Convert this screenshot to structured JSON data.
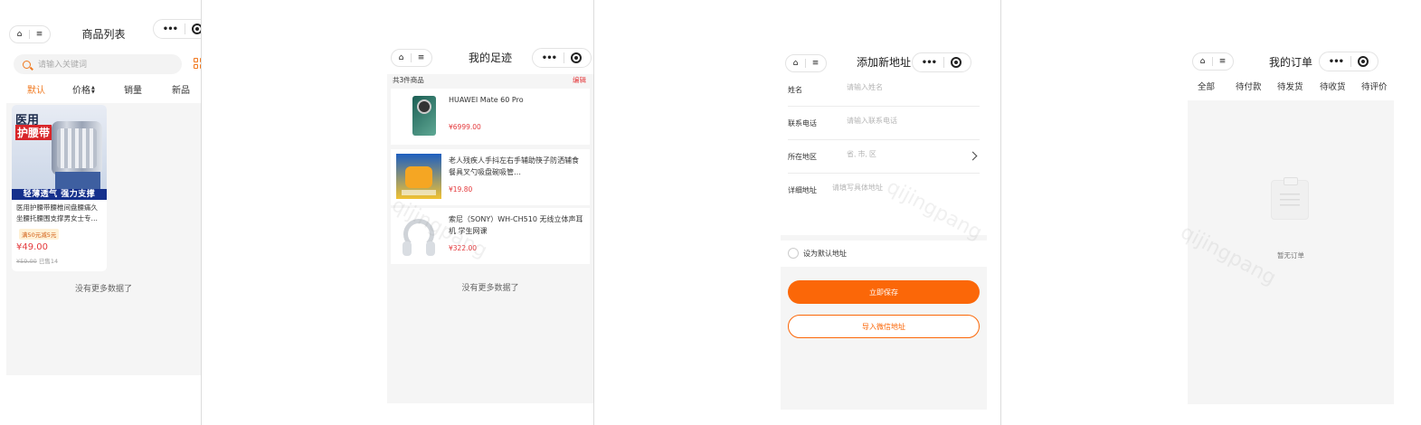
{
  "screen1": {
    "title": "商品列表",
    "search_placeholder": "请输入关键词",
    "sort_tabs": [
      "默认",
      "价格",
      "销量",
      "新品"
    ],
    "price_arrows": "▲▼",
    "product": {
      "image_line1": "医用",
      "image_line2": "护腰带",
      "image_banner": "轻薄透气 强力支撑",
      "title": "医用护腰带腰椎间盘腰痛久坐腰托腰围支撑男女士专…",
      "coupon": "满50元减5元",
      "price": "¥49.00",
      "original_price": "¥59.00",
      "sold": "已售14"
    },
    "no_more": "没有更多数据了"
  },
  "screen2": {
    "title": "我的足迹",
    "count_text": "共3件商品",
    "edit_label": "编辑",
    "items": [
      {
        "name": "HUAWEI Mate 60 Pro",
        "price": "¥6999.00"
      },
      {
        "name": "老人残疾人手抖左右手辅助筷子防洒辅食餐具叉勺吸盘碗吸管…",
        "price": "¥19.80"
      },
      {
        "name": "索尼（SONY）WH-CH510 无线立体声耳机 学生网课",
        "price": "¥322.00"
      }
    ],
    "no_more": "没有更多数据了"
  },
  "screen3": {
    "title": "添加新地址",
    "fields": [
      {
        "label": "姓名",
        "placeholder": "请输入姓名"
      },
      {
        "label": "联系电话",
        "placeholder": "请输入联系电话"
      },
      {
        "label": "所在地区",
        "placeholder": "省, 市, 区"
      },
      {
        "label": "详细地址",
        "placeholder": "请填写具体地址"
      }
    ],
    "default_label": "设为默认地址",
    "save_label": "立即保存",
    "import_label": "导入微信地址"
  },
  "screen4": {
    "title": "我的订单",
    "tabs": [
      "全部",
      "待付款",
      "待发货",
      "待收货",
      "待评价"
    ],
    "empty_text": "暂无订单"
  },
  "watermark": "qijingpang",
  "capsule": {
    "home": "⌂",
    "menu": "≡",
    "more": "•••"
  },
  "colors": {
    "accent": "#fb6708",
    "price": "#e4393c",
    "page_gray": "#f5f5f5"
  }
}
